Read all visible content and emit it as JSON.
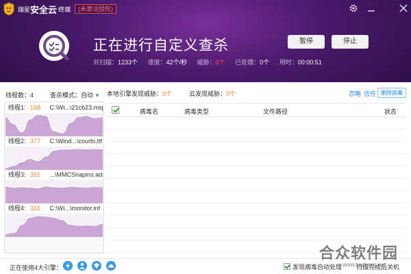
{
  "app": {
    "brand_name": "瑞星",
    "brand_title": "安全云",
    "brand_sub": "终端",
    "license_badge": "(未激活授权)"
  },
  "scan": {
    "title": "正在进行自定义查杀",
    "pause_label": "暂停",
    "stop_label": "停止",
    "stats": {
      "scanned_label": "共扫描：",
      "scanned_value": "1233个",
      "speed_label": "速度：",
      "speed_value": "42个/秒",
      "threats_label": "威胁：",
      "threats_value": "0个",
      "processed_label": "已处理：",
      "processed_value": "0个",
      "time_label": "用时：",
      "time_value": "00:00:51"
    }
  },
  "left": {
    "threads_label": "线程数：4",
    "mode_label": "查杀模式：自动",
    "threads": [
      {
        "name": "线程1:",
        "count": "168",
        "file": "C:\\Wi...\\21cb23.msp",
        "wave": [
          0.85,
          0.55,
          0.2,
          0.75,
          0.95,
          0.9,
          0.25,
          0.15,
          0.6,
          0.85,
          0.9,
          0.8,
          0.85
        ]
      },
      {
        "name": "线程2:",
        "count": "377",
        "file": "C:\\Wind...\\courbi.ttf",
        "wave": [
          0.1,
          0.2,
          0.35,
          0.5,
          0.4,
          0.6,
          0.85,
          0.9,
          0.9,
          0.92,
          0.9,
          0.92,
          0.9
        ]
      },
      {
        "name": "线程3:",
        "count": "391",
        "file": "...\\MMCSnapins.adn",
        "wave": [
          0.75,
          0.7,
          0.72,
          0.7,
          0.68,
          0.75,
          0.72,
          0.7,
          0.74,
          0.72,
          0.7,
          0.73,
          0.72
        ]
      },
      {
        "name": "线程4:",
        "count": "331",
        "file": "C:\\Wi...\\monitor.inf",
        "wave": [
          0.15,
          0.2,
          0.55,
          0.85,
          0.92,
          0.9,
          0.85,
          0.75,
          0.55,
          0.5,
          0.52,
          0.5,
          0.6
        ]
      }
    ]
  },
  "right": {
    "local_label": "本地引擎发现威胁：",
    "local_count": "0个",
    "cloud_label": "云发现威胁：",
    "cloud_count": "0个",
    "ignore_label": "忽略",
    "trust_label": "信任",
    "delete_label": "删除病毒",
    "columns": [
      "病毒名",
      "病毒类型",
      "文件路径",
      "状态"
    ]
  },
  "footer": {
    "engines_label": "正在使用4大引擎：",
    "engine_icons": [
      "lightning-icon",
      "person-icon",
      "shield-icon",
      "cloud-icon"
    ],
    "auto_handle_label": "发现病毒自动处理",
    "shutdown_label": "扫描完成后关机"
  },
  "watermark": {
    "text": "合众软件园",
    "url": "www.hezhong.net"
  },
  "colors": {
    "header_purple": "#4a1a6c",
    "accent_blue": "#2e8bd8",
    "count_orange": "#e5822d",
    "threat_red": "#ff5050",
    "graph_fill": "#c9a6d4"
  }
}
